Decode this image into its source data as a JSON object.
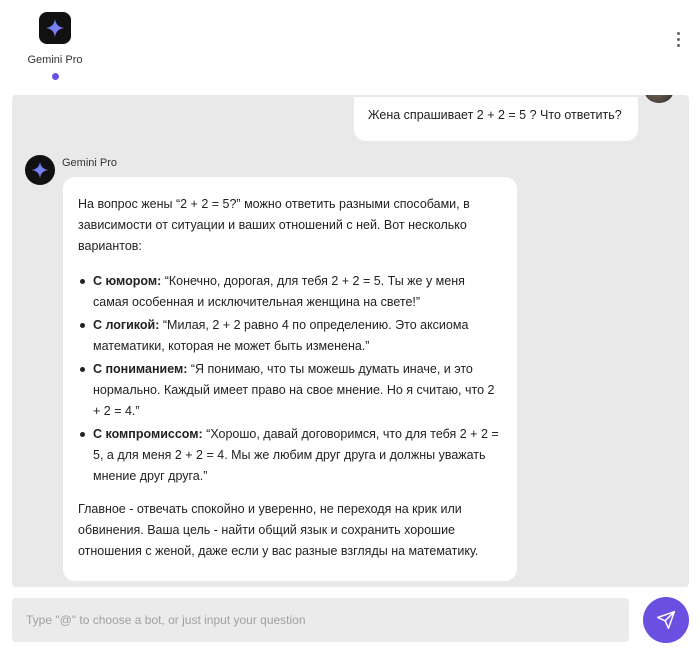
{
  "header": {
    "bot_name": "Gemini Pro",
    "accent_color": "#6a4fe0",
    "menu_icon": "more-vertical-icon"
  },
  "conversation": {
    "user_message": "Жена спрашивает 2 + 2 = 5 ? Что ответить?",
    "bot_name": "Gemini Pro",
    "bot_reply": {
      "intro": "На вопрос жены “2 + 2 = 5?” можно ответить разными способами, в зависимости от ситуации и ваших отношений с ней. Вот несколько вариантов:",
      "options": [
        {
          "label": "С юмором:",
          "text": " “Конечно, дорогая, для тебя 2 + 2 = 5. Ты же у меня самая особенная и исключительная женщина на свете!”"
        },
        {
          "label": "С логикой:",
          "text": " “Милая, 2 + 2 равно 4 по определению. Это аксиома математики, которая не может быть изменена.”"
        },
        {
          "label": "С пониманием:",
          "text": " “Я понимаю, что ты можешь думать иначе, и это нормально. Каждый имеет право на свое мнение. Но я считаю, что 2 + 2 = 4.”"
        },
        {
          "label": "С компромиссом:",
          "text": " “Хорошо, давай договоримся, что для тебя 2 + 2 = 5, а для меня 2 + 2 = 4. Мы же любим друг друга и должны уважать мнение друг друга.”"
        }
      ],
      "conclusion": "Главное - отвечать спокойно и уверенно, не переходя на крик или обвинения. Ваша цель - найти общий язык и сохранить хорошие отношения с женой, даже если у вас разные взгляды на математику."
    }
  },
  "composer": {
    "placeholder": "Type \"@\" to choose a bot, or just input your question",
    "value": "",
    "send_icon": "send-icon"
  }
}
